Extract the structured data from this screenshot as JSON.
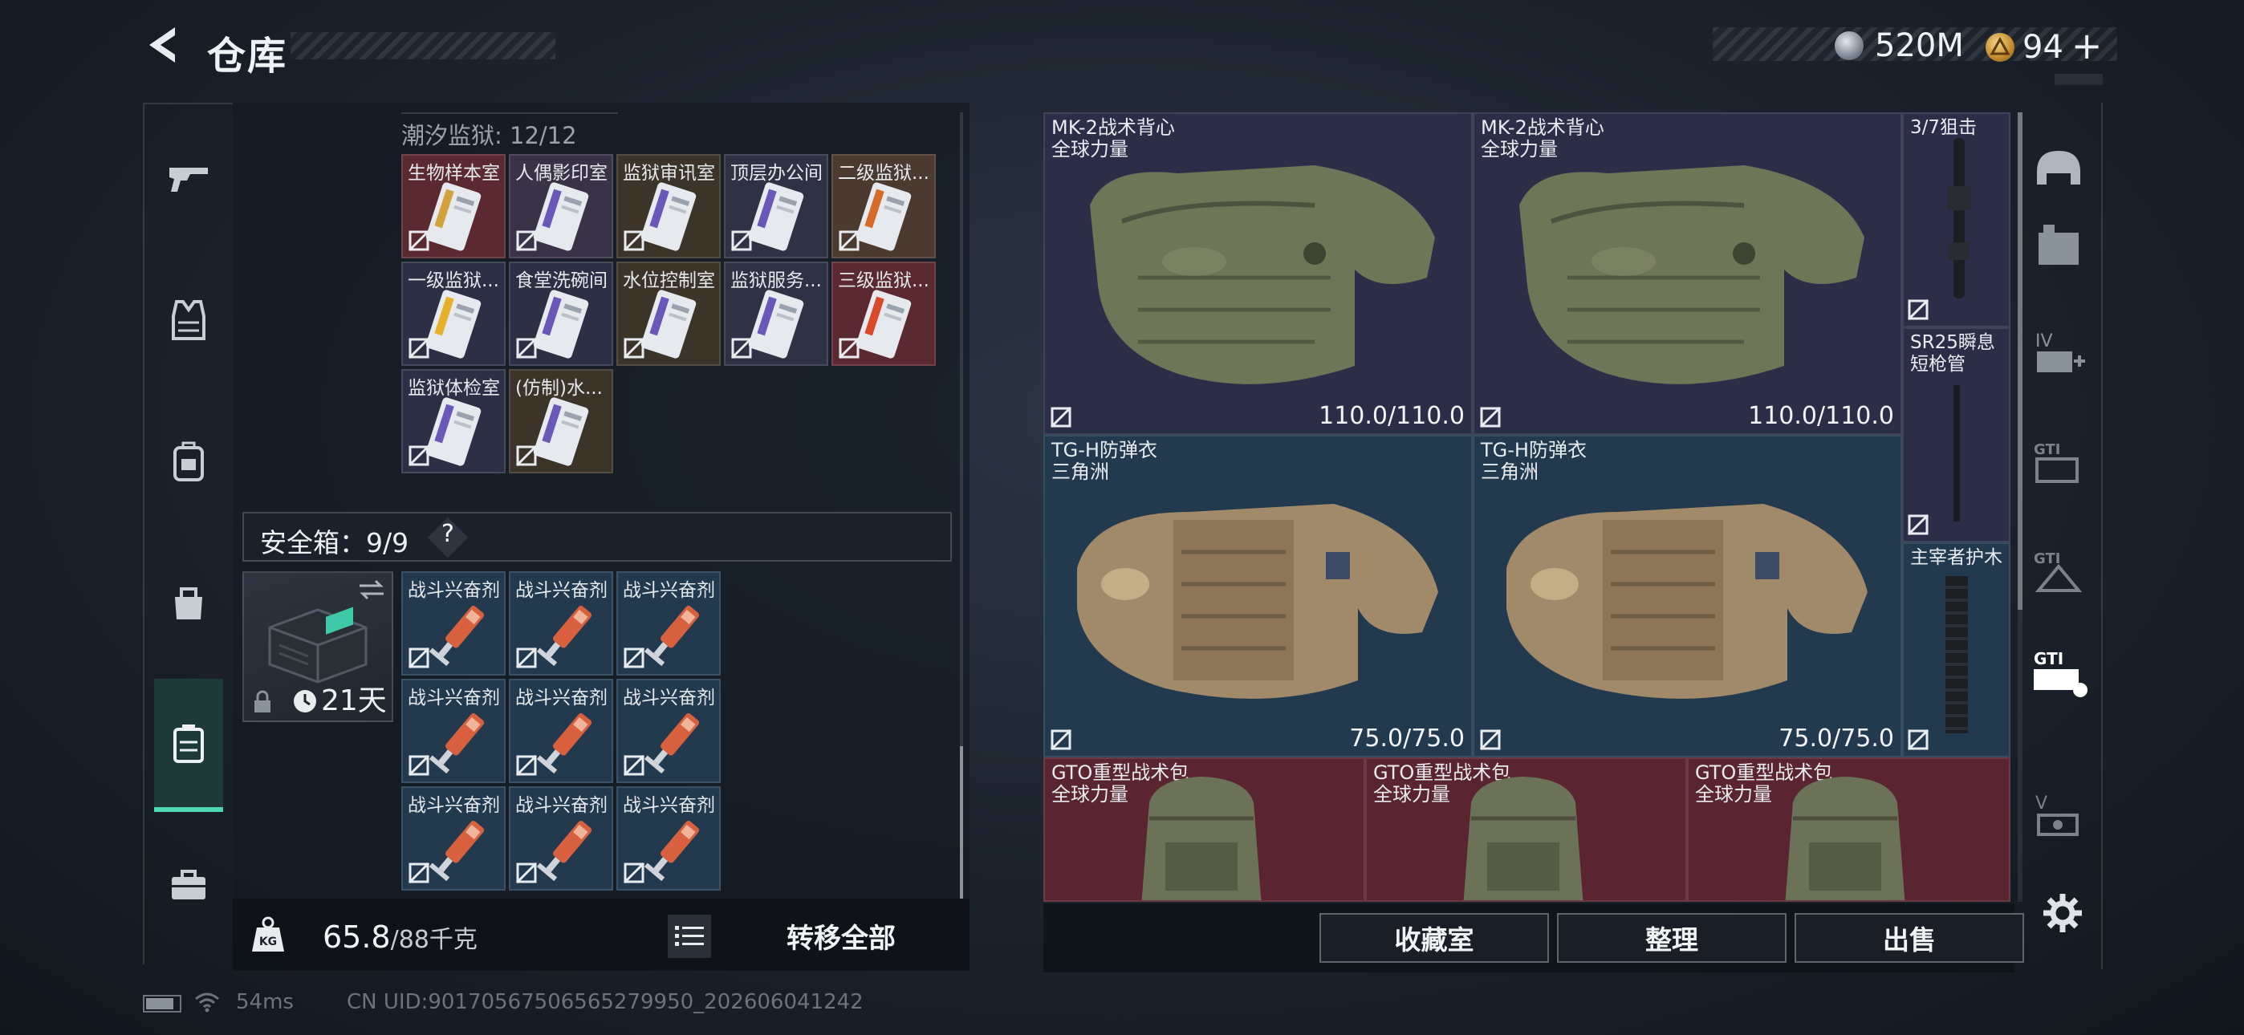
{
  "header": {
    "title": "仓库",
    "currency_primary": "520M",
    "currency_secondary": "94",
    "currency_secondary_plus": "+"
  },
  "left_nav": [
    "gun-icon",
    "armor-icon",
    "backpack-icon",
    "pouch-icon",
    "secure-case-icon",
    "toolbox-icon"
  ],
  "cards_section": {
    "title": "潮汐监狱: 12/12",
    "cards": [
      {
        "label": "生物样本室",
        "color": "#5a2a30",
        "stripe": "#d4a23a"
      },
      {
        "label": "人偶影印室",
        "color": "#3a3348",
        "stripe": "#6a58b8"
      },
      {
        "label": "监狱审讯室",
        "color": "#3c3428",
        "stripe": "#6a58b8"
      },
      {
        "label": "顶层办公间",
        "color": "#2f3145",
        "stripe": "#6a58b8"
      },
      {
        "label": "二级监狱...",
        "color": "#4a3a30",
        "stripe": "#d86a2a"
      },
      {
        "label": "一级监狱...",
        "color": "#2d3044",
        "stripe": "#e6b02a"
      },
      {
        "label": "食堂洗碗间",
        "color": "#2d3044",
        "stripe": "#6a58b8"
      },
      {
        "label": "水位控制室",
        "color": "#3c3428",
        "stripe": "#6a58b8"
      },
      {
        "label": "监狱服务...",
        "color": "#2f3145",
        "stripe": "#6a58b8"
      },
      {
        "label": "三级监狱...",
        "color": "#5a2a30",
        "stripe": "#d84a2a"
      },
      {
        "label": "监狱体检室",
        "color": "#2d3044",
        "stripe": "#6a58b8"
      },
      {
        "label": "(仿制)水...",
        "color": "#3c3428",
        "stripe": "#6a58b8"
      }
    ]
  },
  "safe_box": {
    "label": "安全箱：9/9",
    "help": "?",
    "days": "21天",
    "items": [
      "战斗兴奋剂",
      "战斗兴奋剂",
      "战斗兴奋剂",
      "战斗兴奋剂",
      "战斗兴奋剂",
      "战斗兴奋剂",
      "战斗兴奋剂",
      "战斗兴奋剂",
      "战斗兴奋剂"
    ]
  },
  "bottom_left": {
    "weight_current": "65.8",
    "weight_max": "/88千克",
    "transfer_all": "转移全部"
  },
  "equipment": {
    "vest1": {
      "name": "MK-2战术背心",
      "origin": "全球力量",
      "durability": "110.0/110.0"
    },
    "vest2": {
      "name": "MK-2战术背心",
      "origin": "全球力量",
      "durability": "110.0/110.0"
    },
    "armor1": {
      "name": "TG-H防弹衣",
      "origin": "三角洲",
      "durability": "75.0/75.0"
    },
    "armor2": {
      "name": "TG-H防弹衣",
      "origin": "三角洲",
      "durability": "75.0/75.0"
    },
    "scope": {
      "name": "3/7狙击"
    },
    "barrel": {
      "name1": "SR25瞬息",
      "name2": "短枪管"
    },
    "handguard": {
      "name": "主宰者护木"
    },
    "bag1": {
      "name": "GTO重型战术包",
      "origin": "全球力量"
    },
    "bag2": {
      "name": "GTO重型战术包",
      "origin": "全球力量"
    },
    "bag3": {
      "name": "GTO重型战术包",
      "origin": "全球力量"
    }
  },
  "actions": {
    "collection": "收藏室",
    "sort": "整理",
    "sell": "出售"
  },
  "right_nav": [
    "helmet-icon",
    "armor-slot-icon",
    "level4-plus-icon",
    "gti-icon",
    "gti-chest-icon",
    "gti-rig-icon",
    "level5-icon"
  ],
  "status": {
    "ping": "54ms",
    "uid": "CN UID:9017056750656527995​0_202606041242"
  },
  "colors": {
    "accent": "#4fd6b4",
    "purple_slot": "#2c2e48",
    "blue_slot": "#22394e",
    "red_slot": "#5a2430"
  }
}
